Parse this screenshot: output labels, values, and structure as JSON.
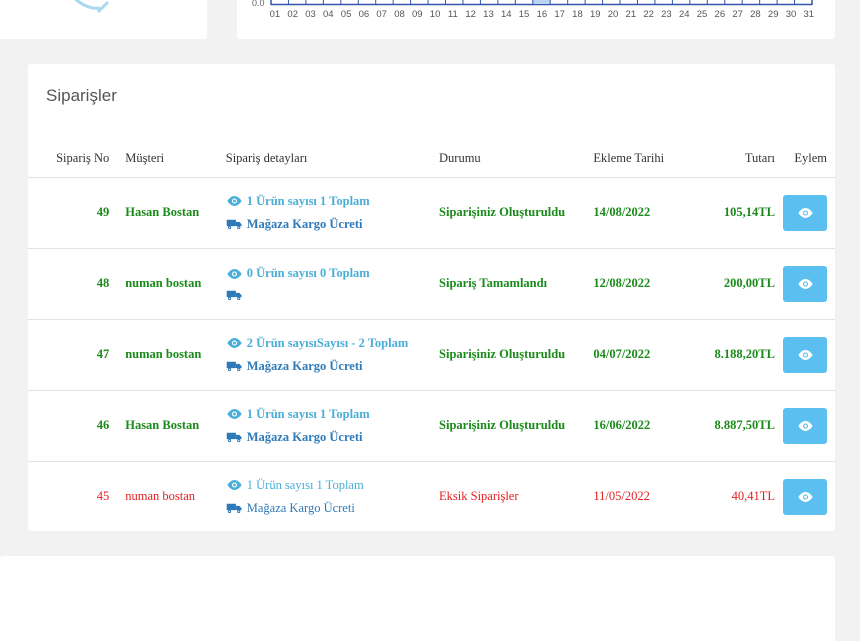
{
  "chart": {
    "zero_label": "0.0",
    "days": [
      "01",
      "02",
      "03",
      "04",
      "05",
      "06",
      "07",
      "08",
      "09",
      "10",
      "11",
      "12",
      "13",
      "14",
      "15",
      "16",
      "17",
      "18",
      "19",
      "20",
      "21",
      "22",
      "23",
      "24",
      "25",
      "26",
      "27",
      "28",
      "29",
      "30",
      "31"
    ],
    "highlight_day": "16",
    "accent_color": "#b8d4f0"
  },
  "orders_panel": {
    "title": "Siparişler",
    "columns": {
      "no": "Sipariş No",
      "customer": "Müşteri",
      "details": "Sipariş detayları",
      "status": "Durumu",
      "date": "Ekleme Tarihi",
      "total": "Tutarı",
      "action": "Eylem"
    },
    "rows": [
      {
        "no": "49",
        "customer": "Hasan Bostan",
        "items": "1 Ürün sayısı 1 Toplam",
        "shipping": "Mağaza Kargo Ücreti",
        "status": "Siparişiniz Oluşturuldu",
        "date": "14/08/2022",
        "total": "105,14TL",
        "state": "ok"
      },
      {
        "no": "48",
        "customer": "numan bostan",
        "items": "0 Ürün sayısı 0 Toplam",
        "shipping": "",
        "status": "Sipariş Tamamlandı",
        "date": "12/08/2022",
        "total": "200,00TL",
        "state": "ok"
      },
      {
        "no": "47",
        "customer": "numan bostan",
        "items": "2 Ürün sayısıSayısı - 2 Toplam",
        "shipping": "Mağaza Kargo Ücreti",
        "status": "Siparişiniz Oluşturuldu",
        "date": "04/07/2022",
        "total": "8.188,20TL",
        "state": "ok"
      },
      {
        "no": "46",
        "customer": "Hasan Bostan",
        "items": "1 Ürün sayısı 1 Toplam",
        "shipping": "Mağaza Kargo Ücreti",
        "status": "Siparişiniz Oluşturuldu",
        "date": "16/06/2022",
        "total": "8.887,50TL",
        "state": "ok"
      },
      {
        "no": "45",
        "customer": "numan bostan",
        "items": "1 Ürün sayısı 1 Toplam",
        "shipping": "Mağaza Kargo Ücreti",
        "status": "Eksik Siparişler",
        "date": "11/05/2022",
        "total": "40,41TL",
        "state": "bad"
      }
    ],
    "colors": {
      "ok": "#1a8a1a",
      "bad": "#e02020",
      "items": "#4aaed8",
      "shipping": "#2e7ab8",
      "button": "#5bc0ef"
    },
    "icons": {
      "details": "eye-icon",
      "shipping": "truck-icon",
      "action": "eye-icon"
    }
  }
}
